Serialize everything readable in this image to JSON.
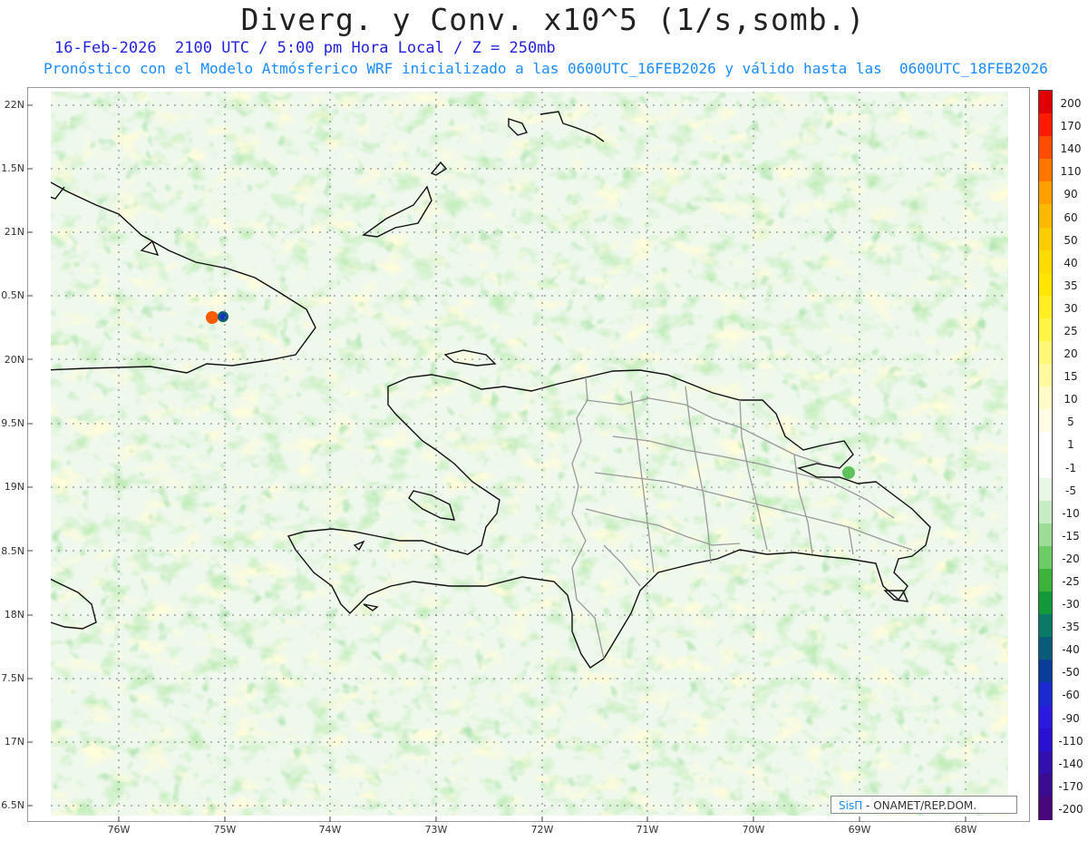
{
  "title": "Diverg. y Conv. x10^5 (1/s,somb.)",
  "subtitle_1": "16-Feb-2026  2100 UTC / 5:00 pm Hora Local / Z = 250mb",
  "subtitle_2": "Pronóstico con el Modelo Atmósferico WRF inicializado a las 0600UTC_16FEB2026 y válido hasta las  0600UTC_18FEB2026",
  "lat_labels": [
    "22N",
    "1.5N",
    "21N",
    "0.5N",
    "20N",
    "9.5N",
    "19N",
    "8.5N",
    "18N",
    "7.5N",
    "17N",
    "6.5N"
  ],
  "lon_labels": [
    "76W",
    "75W",
    "74W",
    "73W",
    "72W",
    "71W",
    "70W",
    "69W",
    "68W"
  ],
  "colorbar": {
    "labels": [
      "200",
      "170",
      "140",
      "110",
      "90",
      "60",
      "50",
      "40",
      "35",
      "30",
      "25",
      "20",
      "15",
      "10",
      "5",
      "1",
      "-1",
      "-5",
      "-10",
      "-15",
      "-20",
      "-25",
      "-30",
      "-35",
      "-40",
      "-50",
      "-60",
      "-90",
      "-110",
      "-140",
      "-170",
      "-200"
    ],
    "colors": [
      "#e00000",
      "#ff1a00",
      "#ff4d00",
      "#ff7700",
      "#ffa000",
      "#ffb800",
      "#ffcc00",
      "#ffdc00",
      "#ffe600",
      "#ffee22",
      "#fff544",
      "#fff877",
      "#fffaa0",
      "#fffcc8",
      "#fffde6",
      "#ffffff",
      "#ffffff",
      "#e8f6e6",
      "#c8ecc4",
      "#9cdc96",
      "#6ccc66",
      "#3cb43c",
      "#129a3a",
      "#0a7a66",
      "#0a5a7a",
      "#0a3c9a",
      "#1a2ad0",
      "#2a1ae0",
      "#2a10d0",
      "#3210b0",
      "#3a0c90",
      "#46087a"
    ]
  },
  "credit": {
    "logo": "SisΠ",
    "text": " - ONAMET/REP.DOM."
  }
}
